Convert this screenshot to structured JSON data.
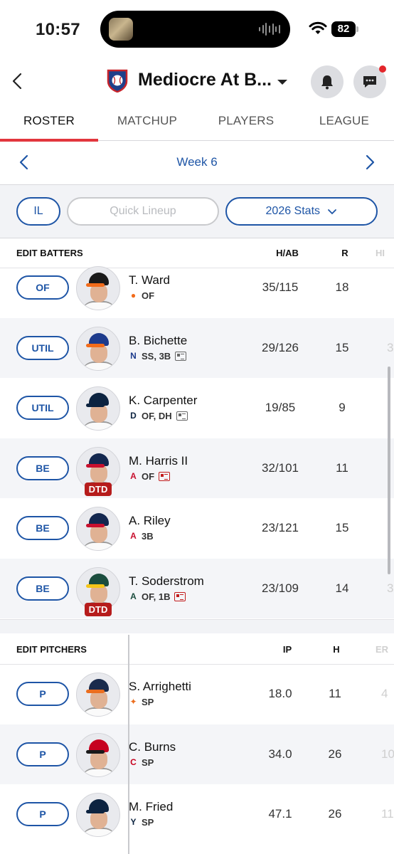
{
  "status_bar": {
    "time": "10:57",
    "battery": "82"
  },
  "header": {
    "team_name": "Mediocre At B..."
  },
  "tabs": [
    {
      "label": "ROSTER",
      "active": true
    },
    {
      "label": "MATCHUP",
      "active": false
    },
    {
      "label": "PLAYERS",
      "active": false
    },
    {
      "label": "LEAGUE",
      "active": false
    }
  ],
  "week": {
    "label": "Week 6"
  },
  "controls": {
    "il_label": "IL",
    "quick_lineup_label": "Quick Lineup",
    "stats_label": "2026 Stats"
  },
  "batters": {
    "title": "EDIT BATTERS",
    "columns": [
      "H/AB",
      "R",
      "HI"
    ],
    "rows": [
      {
        "slot": "OF",
        "name": "T. Ward",
        "positions": "OF",
        "team_icon": "orioles-logo",
        "col1": "35/115",
        "col2": "18",
        "col3": "",
        "status": "",
        "news": ""
      },
      {
        "slot": "UTIL",
        "name": "B. Bichette",
        "positions": "SS, 3B",
        "team_icon": "mets-logo",
        "col1": "29/126",
        "col2": "15",
        "col3": "3",
        "status": "",
        "news": "normal"
      },
      {
        "slot": "UTIL",
        "name": "K. Carpenter",
        "positions": "OF, DH",
        "team_icon": "tigers-logo",
        "col1": "19/85",
        "col2": "9",
        "col3": "",
        "status": "",
        "news": "normal"
      },
      {
        "slot": "BE",
        "name": "M. Harris II",
        "positions": "OF",
        "team_icon": "braves-logo",
        "col1": "32/101",
        "col2": "11",
        "col3": "",
        "status": "DTD",
        "news": "alert"
      },
      {
        "slot": "BE",
        "name": "A. Riley",
        "positions": "3B",
        "team_icon": "braves-logo",
        "col1": "23/121",
        "col2": "15",
        "col3": "",
        "status": "",
        "news": ""
      },
      {
        "slot": "BE",
        "name": "T. Soderstrom",
        "positions": "OF, 1B",
        "team_icon": "athletics-logo",
        "col1": "23/109",
        "col2": "14",
        "col3": "3",
        "status": "DTD",
        "news": "alert"
      }
    ]
  },
  "pitchers": {
    "title": "EDIT PITCHERS",
    "columns": [
      "IP",
      "H",
      "ER"
    ],
    "rows": [
      {
        "slot": "P",
        "name": "S. Arrighetti",
        "positions": "SP",
        "team_icon": "astros-logo",
        "col1": "18.0",
        "col2": "11",
        "col3": "4"
      },
      {
        "slot": "P",
        "name": "C. Burns",
        "positions": "SP",
        "team_icon": "reds-logo",
        "col1": "34.0",
        "col2": "26",
        "col3": "10"
      },
      {
        "slot": "P",
        "name": "M. Fried",
        "positions": "SP",
        "team_icon": "yankees-logo",
        "col1": "47.1",
        "col2": "26",
        "col3": "11"
      }
    ]
  },
  "colors": {
    "accent": "#1e55a6",
    "tab_underline": "#e2363d",
    "dtd": "#b61c1c"
  }
}
